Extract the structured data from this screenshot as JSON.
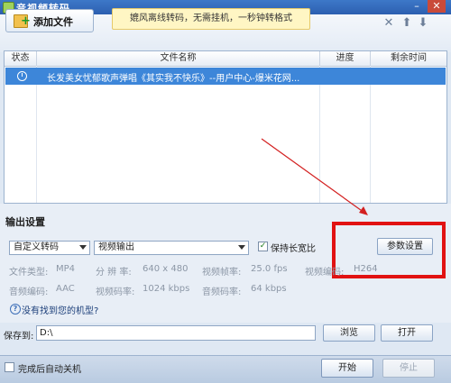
{
  "window": {
    "title": "音视频转码",
    "minimize_icon": "minimize-icon",
    "close_icon": "close-icon"
  },
  "toolbar": {
    "add_file_label": "添加文件",
    "promo_text": "媲风离线转码，无需挂机，一秒钟转格式",
    "icons": [
      "delete-icon",
      "move-up-icon",
      "move-down-icon"
    ]
  },
  "file_list": {
    "columns": [
      "状态",
      "文件名称",
      "进度",
      "剩余时间"
    ],
    "rows": [
      {
        "status_icon": "clock-icon",
        "name": "长发美女忧郁歌声弹唱《其实我不快乐》--用户中心-爆米花网...",
        "progress": "",
        "remaining": ""
      }
    ]
  },
  "output": {
    "title": "输出设置",
    "preset_select": "自定义转码",
    "format_select": "视频输出",
    "keep_ratio_label": "保持长宽比",
    "keep_ratio_checked": true,
    "param_button": "参数设置",
    "info_row1": {
      "file_type_label": "文件类型:",
      "file_type": "MP4",
      "resolution_label": "分 辨 率:",
      "resolution": "640 x 480",
      "framerate_label": "视频帧率:",
      "framerate": "25.0 fps",
      "vcodec_label": "视频编码:",
      "vcodec": "H264"
    },
    "info_row2": {
      "acodec_label": "音频编码:",
      "acodec": "AAC",
      "vbitrate_label": "视频码率:",
      "vbitrate": "1024 kbps",
      "abitrate_label": "音频码率:",
      "abitrate": "64 kbps"
    },
    "help_link": "没有找到您的机型?"
  },
  "save": {
    "label": "保存到:",
    "path": "D:\\",
    "browse": "浏览",
    "open": "打开"
  },
  "bottom": {
    "shutdown_label": "完成后自动关机",
    "start": "开始",
    "stop": "停止"
  },
  "colors": {
    "highlight": "#e11212",
    "selection": "#3d86d9"
  }
}
